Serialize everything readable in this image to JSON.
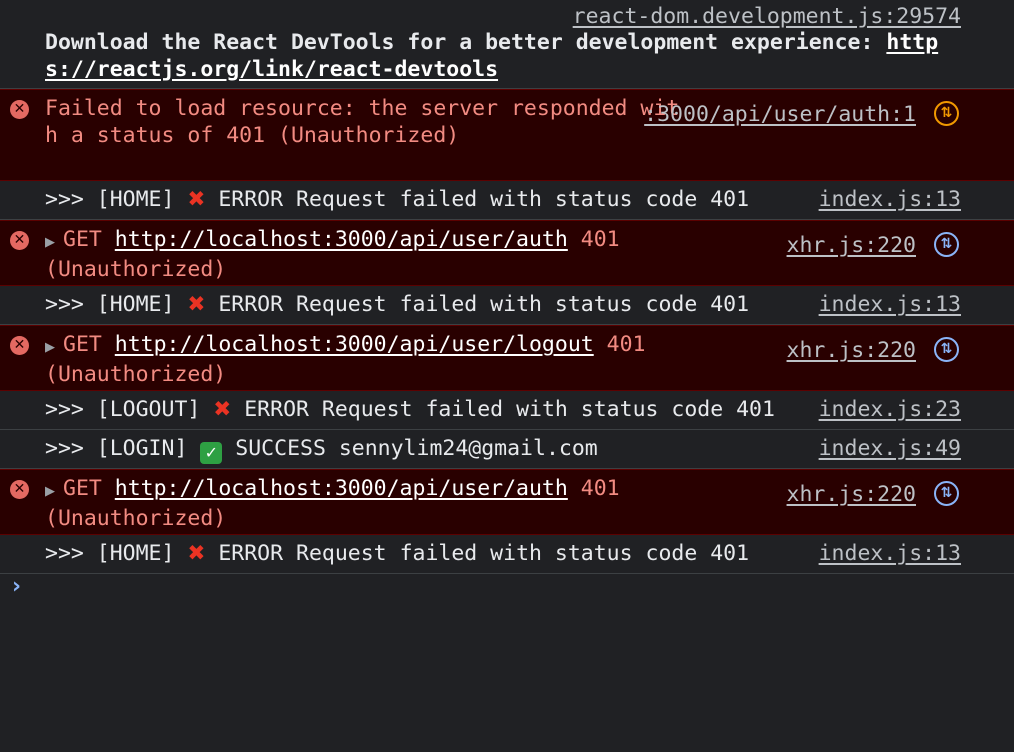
{
  "rows": {
    "devtools": {
      "source": "react-dom.development.js:29574",
      "message": "Download the React DevTools for a better development experience: ",
      "link": "https://reactjs.org/link/react-devtools"
    },
    "resource_error": {
      "message": "Failed to load resource: the server responded with a status of 401 (Unauthorized)",
      "source": ":3000/api/user/auth:1"
    },
    "home_error_1": {
      "prefix": ">>> [HOME] ",
      "icon": "cross-mark-icon",
      "text": " ERROR Request failed with status code 401",
      "source": "index.js:13"
    },
    "get_auth_1": {
      "method": "GET ",
      "url": "http://localhost:3000/api/user/auth",
      "status": " 401",
      "status_text": "(Unauthorized)",
      "source": "xhr.js:220"
    },
    "home_error_2": {
      "prefix": ">>> [HOME] ",
      "icon": "cross-mark-icon",
      "text": " ERROR Request failed with status code 401",
      "source": "index.js:13"
    },
    "get_logout": {
      "method": "GET ",
      "url": "http://localhost:3000/api/user/logout",
      "status": " 401",
      "status_text": "(Unauthorized)",
      "source": "xhr.js:220"
    },
    "logout_error": {
      "prefix": ">>> [LOGOUT] ",
      "icon": "cross-mark-icon",
      "text": " ERROR Request failed with status code 401",
      "source": "index.js:23"
    },
    "login_success": {
      "prefix": ">>> [LOGIN] ",
      "icon": "check-mark-icon",
      "text": " SUCCESS sennylim24@gmail.com",
      "source": "index.js:49"
    },
    "get_auth_2": {
      "method": "GET ",
      "url": "http://localhost:3000/api/user/auth",
      "status": " 401",
      "status_text": "(Unauthorized)",
      "source": "xhr.js:220"
    },
    "home_error_3": {
      "prefix": ">>> [HOME] ",
      "icon": "cross-mark-icon",
      "text": " ERROR Request failed with status code 401",
      "source": "index.js:13"
    }
  },
  "colors": {
    "background": "#202124",
    "error_background": "#290000",
    "error_text": "#f28b82",
    "prompt": "#8ab4f8"
  }
}
